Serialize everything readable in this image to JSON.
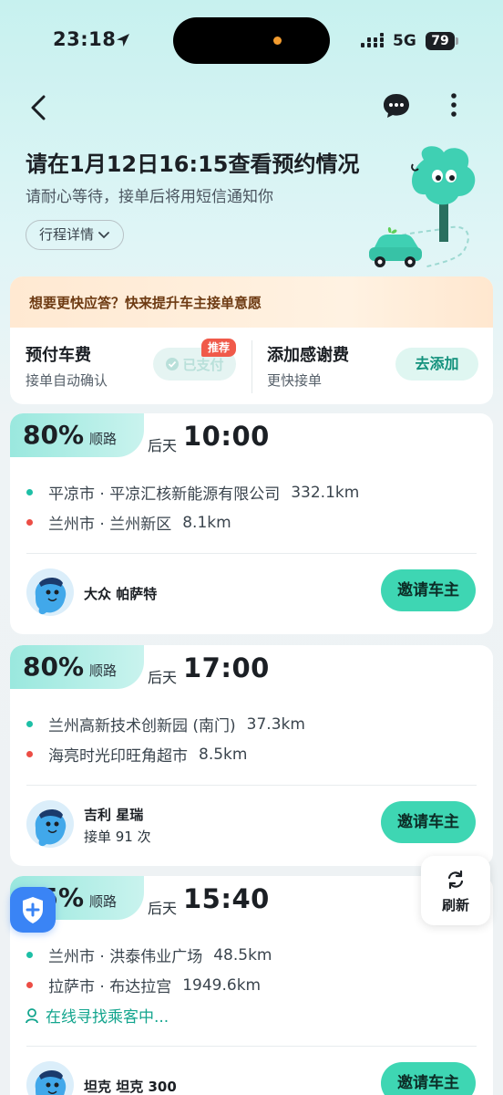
{
  "status_bar": {
    "time": "23:18",
    "network": "5G",
    "battery": "79"
  },
  "header": {
    "title": "请在1月12日16:15查看预约情况",
    "subtitle": "请耐心等待，接单后将用短信通知你",
    "detail_button": "行程详情"
  },
  "prepay": {
    "banner": "想要更快应答？快来提升车主接单意愿",
    "left_title": "预付车费",
    "left_sub": "接单自动确认",
    "paid_label": "已支付",
    "recommend_badge": "推荐",
    "right_title": "添加感谢费",
    "right_sub": "更快接单",
    "add_button": "去添加"
  },
  "trips": [
    {
      "match_percent": "80%",
      "match_label": "顺路",
      "day": "后天",
      "time": "10:00",
      "origin": "平凉市 · 平凉汇核新能源有限公司",
      "origin_distance": "332.1km",
      "destination": "兰州市 · 兰州新区",
      "destination_distance": "8.1km",
      "car": "大众 帕萨特",
      "orders": "",
      "invite_button": "邀请车主"
    },
    {
      "match_percent": "80%",
      "match_label": "顺路",
      "day": "后天",
      "time": "17:00",
      "origin": "兰州高新技术创新园 (南门)",
      "origin_distance": "37.3km",
      "destination": "海亮时光印旺角超市",
      "destination_distance": "8.5km",
      "car": "吉利 星瑞",
      "orders": "接单 91 次",
      "invite_button": "邀请车主"
    },
    {
      "match_percent": "75%",
      "match_label": "顺路",
      "day": "后天",
      "time": "15:40",
      "origin": "兰州市 · 洪泰伟业广场",
      "origin_distance": "48.5km",
      "destination": "拉萨市 · 布达拉宫",
      "destination_distance": "1949.6km",
      "seeking": "在线寻找乘客中...",
      "car": "坦克 坦克 300",
      "orders": "",
      "invite_button": "邀请车主"
    }
  ],
  "refresh_label": "刷新",
  "colors": {
    "accent": "#3ed6b3",
    "origin_dot": "#1dbfa6",
    "destination_dot": "#ec4d45",
    "badge": "#f05a4a"
  }
}
